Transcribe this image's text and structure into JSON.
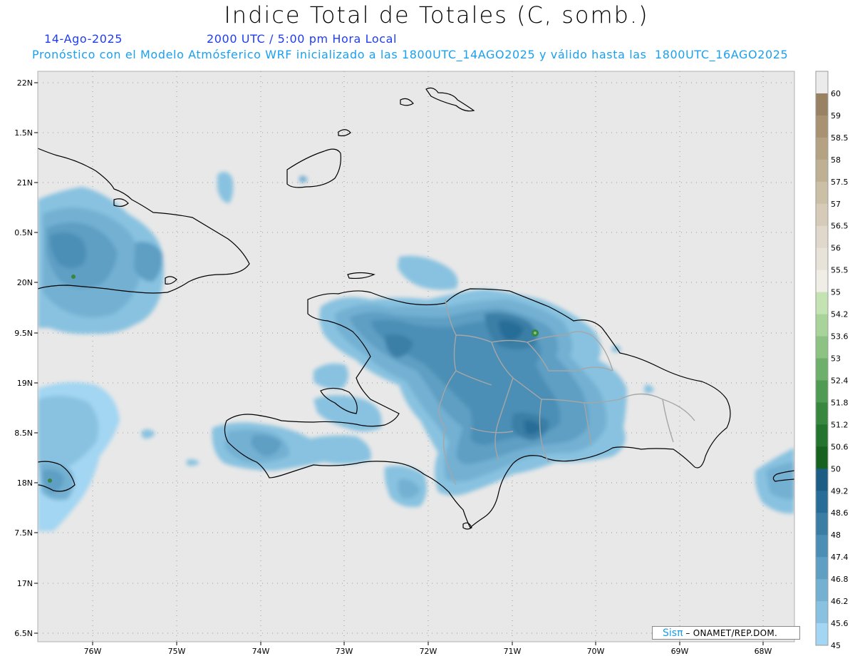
{
  "header": {
    "title": "Indice Total de Totales (C, somb.)",
    "date": "14-Ago-2025",
    "time": "2000 UTC / 5:00 pm Hora Local",
    "subtitle": "Pronóstico con el Modelo Atmósferico WRF inicializado a las 1800UTC_14AGO2025 y válido hasta las  1800UTC_16AGO2025"
  },
  "map": {
    "lat_labels": [
      "22N",
      "1.5N",
      "21N",
      "0.5N",
      "20N",
      "9.5N",
      "19N",
      "8.5N",
      "18N",
      "7.5N",
      "17N",
      "6.5N"
    ],
    "lon_labels": [
      "76W",
      "75W",
      "74W",
      "73W",
      "72W",
      "71W",
      "70W",
      "69W",
      "68W"
    ],
    "background_color": "#e8e8e8",
    "coastline_color": "#000000",
    "border_color": "#a0a0a0"
  },
  "colorbar": {
    "labels": [
      "60",
      "59",
      "58.5",
      "58",
      "57.5",
      "57",
      "56.5",
      "56",
      "55.5",
      "55",
      "54.2",
      "53.6",
      "53",
      "52.4",
      "51.8",
      "51.2",
      "50.6",
      "50",
      "49.2",
      "48.6",
      "48",
      "47.4",
      "46.8",
      "46.2",
      "45.6",
      "45"
    ],
    "colors": [
      "#ebebeb",
      "#998163",
      "#a99272",
      "#b5a283",
      "#c0b093",
      "#cbbfa6",
      "#d5cbb8",
      "#dfd8cb",
      "#e8e3d8",
      "#efede6",
      "#c4e3b3",
      "#a8d49a",
      "#8cc382",
      "#6db06a",
      "#4f9b52",
      "#37873e",
      "#23742c",
      "#18621f",
      "#1c5d86",
      "#286d97",
      "#3a7ea6",
      "#4b8fb6",
      "#5f9fc4",
      "#73b0d2",
      "#88c2e0",
      "#a3d6f2"
    ]
  },
  "credit": {
    "logo": "Sisπ",
    "org": "– ONAMET/REP.DOM."
  }
}
